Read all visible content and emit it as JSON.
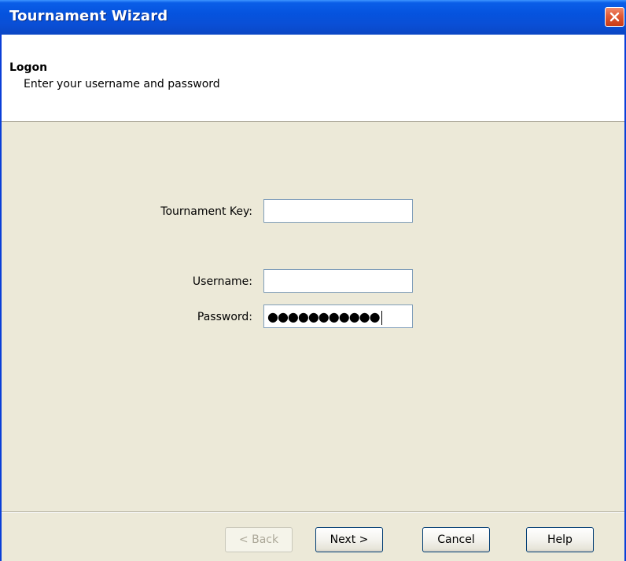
{
  "window": {
    "title": "Tournament Wizard"
  },
  "header": {
    "title": "Logon",
    "subtitle": "Enter your username and password"
  },
  "form": {
    "tournament_key": {
      "label": "Tournament Key:",
      "value": ""
    },
    "username": {
      "label": "Username:",
      "value": ""
    },
    "password": {
      "label": "Password:",
      "masked_value": "●●●●●●●●●●●",
      "focused": true
    }
  },
  "buttons": {
    "back": {
      "label": "< Back",
      "enabled": false
    },
    "next": {
      "label": "Next >",
      "enabled": true
    },
    "cancel": {
      "label": "Cancel",
      "enabled": true
    },
    "help": {
      "label": "Help",
      "enabled": true
    }
  },
  "icons": {
    "close": "close-icon"
  },
  "colors": {
    "titlebar": "#0553de",
    "close_button": "#e05a35",
    "window_bg": "#ece9d8",
    "input_border": "#7f9db9"
  }
}
